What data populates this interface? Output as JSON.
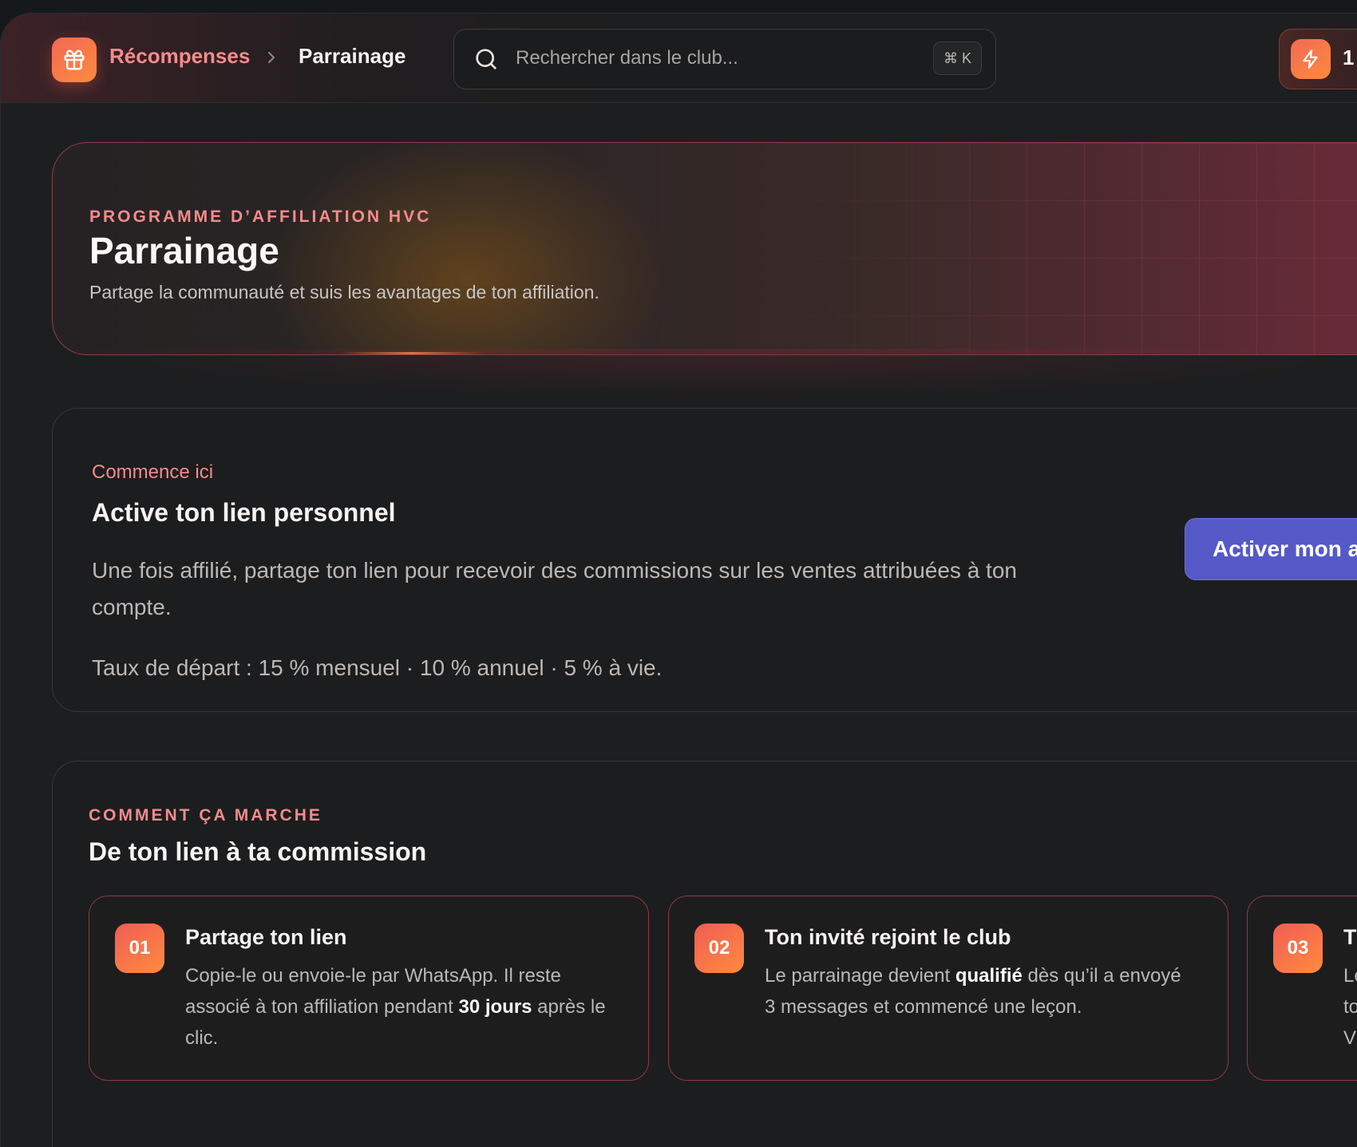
{
  "topbar": {
    "breadcrumb_parent": "Récompenses",
    "breadcrumb_current": "Parrainage",
    "search_placeholder": "Rechercher dans le club...",
    "search_shortcut": "⌘ K",
    "streak_count": "1"
  },
  "hero": {
    "eyebrow": "PROGRAMME D’AFFILIATION HVC",
    "title": "Parrainage",
    "subtitle": "Partage la communauté et suis les avantages de ton affiliation."
  },
  "start": {
    "kicker": "Commence ici",
    "heading": "Active ton lien personnel",
    "description": "Une fois affilié, partage ton lien pour recevoir des commissions sur les ventes attribuées à ton compte.",
    "rates": "Taux de départ : 15 % mensuel · 10 % annuel · 5 % à vie.",
    "button_label": "Activer mon affi"
  },
  "how": {
    "eyebrow": "COMMENT ÇA MARCHE",
    "heading": "De ton lien à ta commission",
    "steps": [
      {
        "number": "01",
        "title": "Partage ton lien",
        "body_before": "Copie-le ou envoie-le par WhatsApp. Il reste associé à ton affiliation pendant ",
        "body_bold": "30 jours",
        "body_after": " après le clic."
      },
      {
        "number": "02",
        "title": "Ton invité rejoint le club",
        "body_before": "Le parrainage devient ",
        "body_bold": "qualifié",
        "body_after": " dès qu’il a envoyé 3 messages et commencé une leçon."
      },
      {
        "number": "03",
        "title": "T",
        "body_line1": "Le",
        "body_line2": "to",
        "body_line3": "V"
      }
    ]
  },
  "colors": {
    "accent_pink": "#f48b8e",
    "accent_orange": "#ff8a3d",
    "button_indigo": "#5559c8",
    "background": "#1d1e1f"
  }
}
